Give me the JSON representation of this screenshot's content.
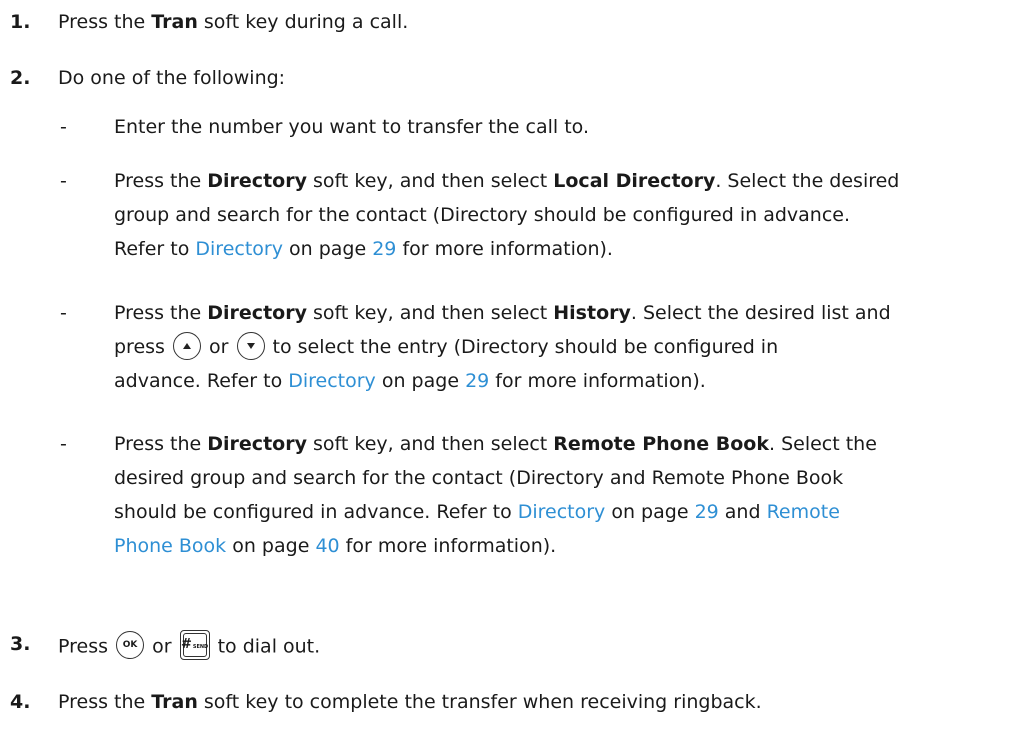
{
  "steps": [
    {
      "num": "1.",
      "pre": "Press the ",
      "bold": "Tran",
      "post": " soft key during a call."
    },
    {
      "num": "2.",
      "text": "Do one of the following:"
    },
    {
      "num": "3.",
      "pre": "Press ",
      "mid": " or ",
      "post": " to dial out."
    },
    {
      "num": "4.",
      "pre": "Press the ",
      "bold": "Tran",
      "post": " soft key to complete the transfer when receiving ringback."
    }
  ],
  "dash": "-",
  "sub1": {
    "text": "Enter the number you want to transfer the call to."
  },
  "sub2": {
    "pre": "Press the ",
    "bold1": "Directory",
    "mid": " soft key, and then select ",
    "bold2": "Local Directory",
    "post": ". Select the desired",
    "line2": "group and search for the contact (Directory should be configured in advance.",
    "refer": "Refer to ",
    "link": "Directory",
    "onpage": " on page ",
    "page": "29",
    "tail": " for more information)."
  },
  "sub3": {
    "pre": "Press the ",
    "bold1": "Directory",
    "mid": " soft key, and then select ",
    "bold2": "History",
    "post": ". Select the desired list and",
    "press": "press ",
    "or": " or ",
    "after": " to select the entry (Directory should be configured in",
    "adv": "advance. Refer to ",
    "link": "Directory",
    "onpage": " on page ",
    "page": "29",
    "tail": " for more information)."
  },
  "sub4": {
    "pre": "Press the ",
    "bold1": "Directory",
    "mid": " soft key, and then select ",
    "bold2": "Remote Phone Book",
    "post": ". Select the",
    "line2": "desired group and search for the contact (Directory and Remote Phone Book",
    "line3pre": "should be configured in advance. Refer to ",
    "link1": "Directory",
    "onpage1": " on page ",
    "page1": "29",
    "and": " and ",
    "link2a": "Remote",
    "link2b": "Phone Book",
    "onpage2": " on page ",
    "page2": "40",
    "tail": " for more information)."
  },
  "icons": {
    "up": "up-arrow-key-icon",
    "down": "down-arrow-key-icon",
    "ok": "OK",
    "send_hash": "#",
    "send_label": "SEND"
  }
}
